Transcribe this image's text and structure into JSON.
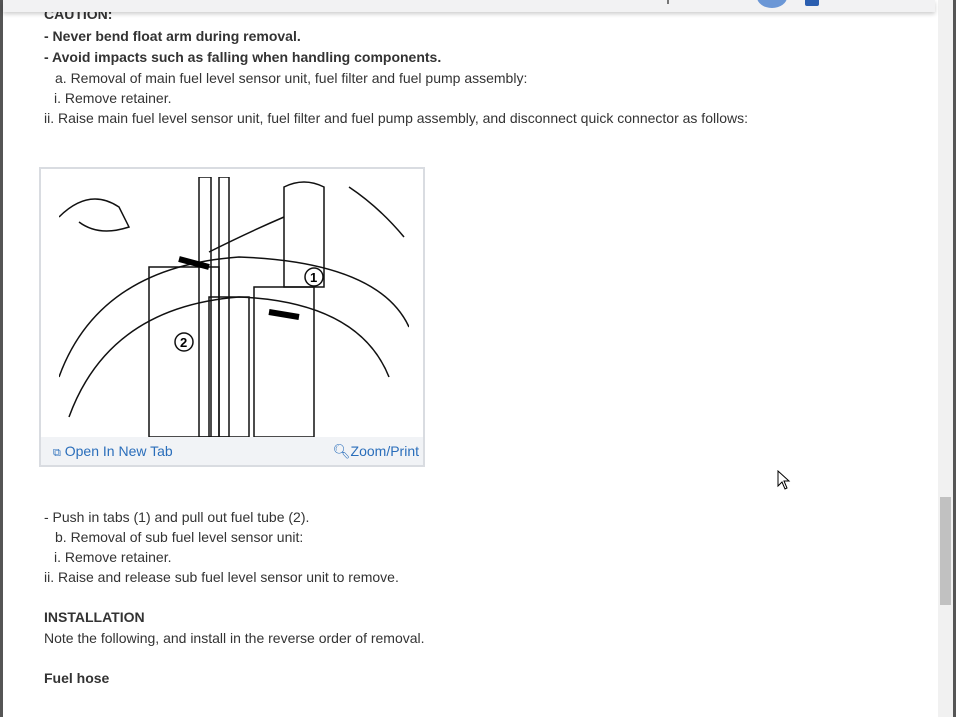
{
  "caution": {
    "heading": "CAUTION:",
    "items": [
      "-  Never bend float arm during removal.",
      "-  Avoid impacts such as falling when handling components."
    ]
  },
  "steps_top": [
    "a. Removal of main fuel level sensor unit, fuel filter and fuel pump assembly:",
    "i. Remove retainer.",
    "ii. Raise main fuel level sensor unit, fuel filter and fuel pump assembly, and disconnect quick connector as follows:"
  ],
  "figure": {
    "callouts": [
      "1",
      "2"
    ],
    "open_new_tab": "Open In New Tab",
    "zoom_print": "Zoom/Print"
  },
  "steps_bottom": [
    "-  Push in tabs (1) and pull out fuel tube (2).",
    "b. Removal of sub fuel level sensor unit:",
    "i. Remove retainer.",
    "ii. Raise and release sub fuel level sensor unit to remove."
  ],
  "installation": {
    "heading": "INSTALLATION",
    "note": "Note the following, and install in the reverse order of removal.",
    "subheading": "Fuel hose"
  },
  "colors": {
    "link": "#2a6ebb",
    "text": "#333333"
  }
}
